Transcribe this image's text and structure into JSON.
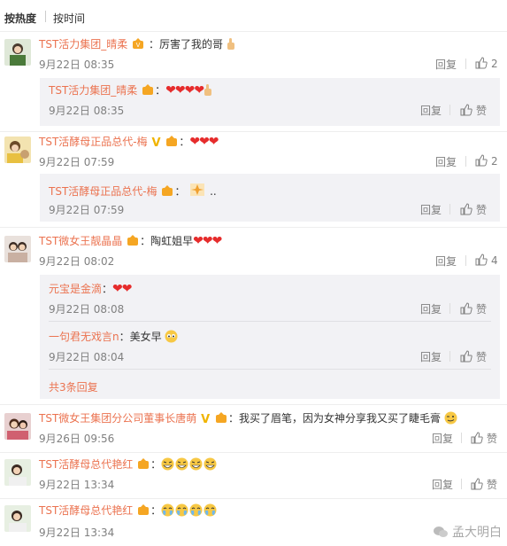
{
  "sort": {
    "hot": "按热度",
    "time": "按时间"
  },
  "labels": {
    "reply": "回复",
    "like": "赞"
  },
  "colors": {
    "username": "#eb7350",
    "subbox": "#f2f2f5"
  },
  "comments": [
    {
      "user": "TST活力集团_晴柔",
      "text": "：厉害了我的哥",
      "time": "9月22日 08:35",
      "likes": "2",
      "reply": {
        "user": "TST活力集团_晴柔",
        "text": "",
        "time": "9月22日 08:35",
        "likes": "赞"
      }
    },
    {
      "user": "TST活酵母正品总代-梅",
      "text": "：",
      "time": "9月22日 07:59",
      "likes": "2",
      "reply": {
        "user": "TST活酵母正品总代-梅",
        "text": "..",
        "time": "9月22日 07:59",
        "likes": "赞"
      }
    },
    {
      "user": "TST微女王靓晶晶",
      "text": "：陶虹姐早",
      "time": "9月22日 08:02",
      "likes": "4",
      "replies": [
        {
          "user": "元宝是金滴",
          "text": "：",
          "time": "9月22日 08:08",
          "likes": "赞"
        },
        {
          "user": "一句君无戏言n",
          "text": "：美女早",
          "time": "9月22日 08:04",
          "likes": "赞"
        }
      ],
      "more": "共3条回复"
    },
    {
      "user": "TST微女王集团分公司董事长唐萌",
      "text": "：我买了眉笔，因为女神分享我又买了睫毛膏",
      "time": "9月26日 09:56",
      "likes": "赞"
    },
    {
      "user": "TST活酵母总代艳红",
      "text": "：",
      "time": "9月22日 13:34",
      "likes": "赞"
    },
    {
      "user": "TST活酵母总代艳红",
      "text": "：",
      "time": "9月22日 13:34",
      "likes": ""
    }
  ],
  "watermark": "孟大明白"
}
